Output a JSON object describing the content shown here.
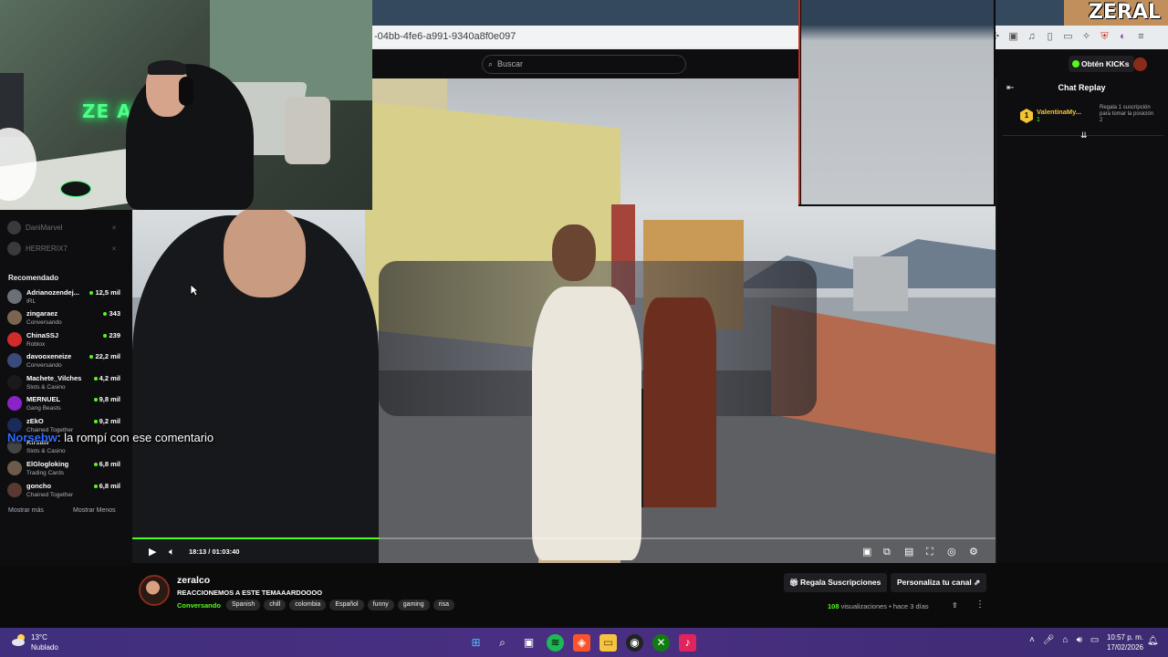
{
  "browser": {
    "url_fragment": "-04bb-4fe6-a991-9340a8f0e097"
  },
  "header": {
    "search_placeholder": "Buscar",
    "get_kicks_label": "Obtén KICKs",
    "brand_color": "#53fc18"
  },
  "overlay_logo": "ZERAL",
  "sidebar": {
    "following": [
      {
        "name": "DaniMarvel"
      },
      {
        "name": "HERRERIX7"
      }
    ],
    "recommended_heading": "Recomendado",
    "recommended": [
      {
        "name": "Adrianozendej...",
        "category": "IRL",
        "viewers": "12,5 mil",
        "color": "#6b6f78"
      },
      {
        "name": "zingaraez",
        "category": "Conversando",
        "viewers": "343",
        "color": "#7a6550"
      },
      {
        "name": "ChinaSSJ",
        "category": "Roblox",
        "viewers": "239",
        "color": "#d02a2a"
      },
      {
        "name": "davooxeneize",
        "category": "Conversando",
        "viewers": "22,2 mil",
        "color": "#3a4a7a"
      },
      {
        "name": "Machete_Vilches",
        "category": "Slots & Casino",
        "viewers": "4,2 mil",
        "color": "#1a1a1a"
      },
      {
        "name": "MERNUEL",
        "category": "Gang Beasts",
        "viewers": "9,8 mil",
        "color": "#8a22c8"
      },
      {
        "name": "zEkO",
        "category": "Chained Together",
        "viewers": "9,2 mil",
        "color": "#1c2a5a"
      },
      {
        "name": "Kirsaw",
        "category": "Slots & Casino",
        "viewers": "",
        "color": "#444"
      },
      {
        "name": "ElGlogloking",
        "category": "Trading Cards",
        "viewers": "6,8 mil",
        "color": "#6d5a4a"
      },
      {
        "name": "goncho",
        "category": "Chained Together",
        "viewers": "6,8 mil",
        "color": "#5a3a30"
      }
    ],
    "show_more": "Mostrar más",
    "show_less": "Mostrar Menos"
  },
  "video": {
    "overlay_user": "Norsebw",
    "overlay_text": ": la rompí con ese comentario",
    "time_current": "18:13",
    "time_total": "01:03:40",
    "progress_fraction": 0.286
  },
  "chat": {
    "title": "Chat Replay",
    "gift": {
      "badge": "1",
      "user": "ValentinaMy...",
      "count": "1",
      "text": "Regala 1 suscripción para tomar la posición 2"
    }
  },
  "channel": {
    "name": "zeralco",
    "stream_title": "REACCIONEMOS A ESTE TEMAAARDOOOO",
    "category": "Conversando",
    "tags": [
      "Spanish",
      "chill",
      "colombia",
      "Español",
      "funny",
      "gaming",
      "risa"
    ],
    "gift_subs_label": "Regala Suscripciones",
    "customize_label": "Personaliza tu canal",
    "views_count": "108",
    "views_label": "visualizaciones",
    "separator": "•",
    "ago": "hace 3 días"
  },
  "taskbar": {
    "temp": "13°C",
    "weather": "Nublado",
    "time": "10:57 p. m.",
    "date": "17/02/2026"
  }
}
